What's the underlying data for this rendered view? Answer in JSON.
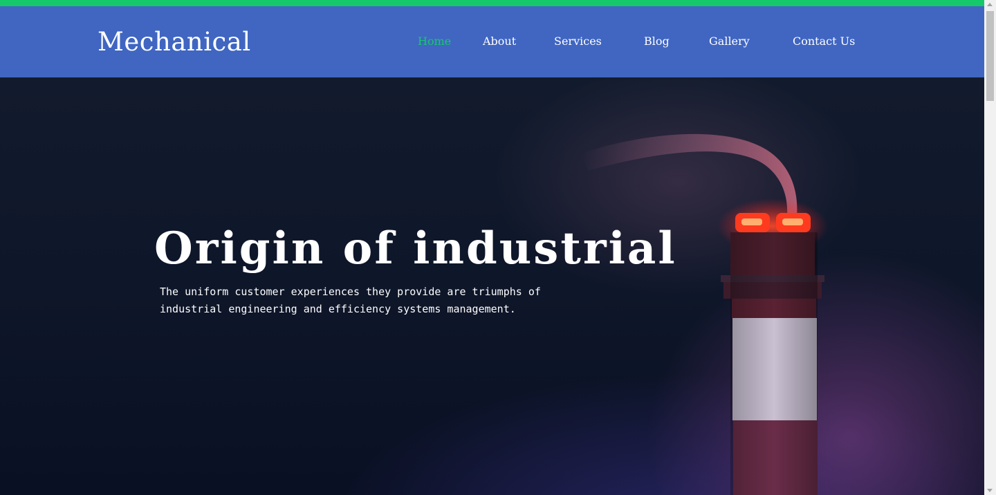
{
  "brand": {
    "name": "Mechanical"
  },
  "colors": {
    "accent": "#15c86a",
    "header_bg": "#4066c2",
    "hero_bg": "#0e1629"
  },
  "nav": {
    "items": [
      {
        "label": "Home",
        "active": true
      },
      {
        "label": "About",
        "active": false
      },
      {
        "label": "Services",
        "active": false
      },
      {
        "label": "Blog",
        "active": false
      },
      {
        "label": "Gallery",
        "active": false
      },
      {
        "label": "Contact Us",
        "active": false
      }
    ]
  },
  "hero": {
    "title": "Origin of industrial",
    "description": "The uniform customer experiences they provide are triumphs of industrial engineering and efficiency systems management.",
    "image_icon": "smokestack-image"
  }
}
